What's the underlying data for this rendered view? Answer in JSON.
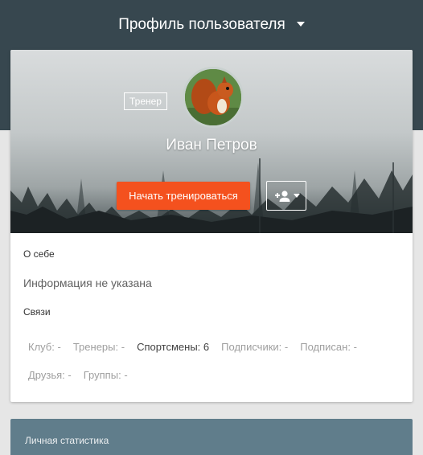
{
  "header": {
    "title": "Профиль пользователя"
  },
  "profile": {
    "role_badge": "Тренер",
    "name": "Иван Петров",
    "start_button": "Начать тренироваться",
    "follow_icon": "add-person-icon"
  },
  "about": {
    "title": "О себе",
    "text": "Информация не указана"
  },
  "links": {
    "title": "Связи",
    "row1": [
      {
        "label": "Клуб:",
        "value": "-"
      },
      {
        "label": "Тренеры:",
        "value": "-"
      },
      {
        "label": "Спортсмены:",
        "value": "6"
      },
      {
        "label": "Подписчики:",
        "value": "-"
      },
      {
        "label": "Подписан:",
        "value": "-"
      }
    ],
    "row2": [
      {
        "label": "Друзья:",
        "value": "-"
      },
      {
        "label": "Группы:",
        "value": "-"
      }
    ]
  },
  "stats": {
    "title": "Личная статистика"
  },
  "colors": {
    "header_bg": "#37474f",
    "accent": "#f4511e",
    "stats_bg": "#607d8b"
  }
}
